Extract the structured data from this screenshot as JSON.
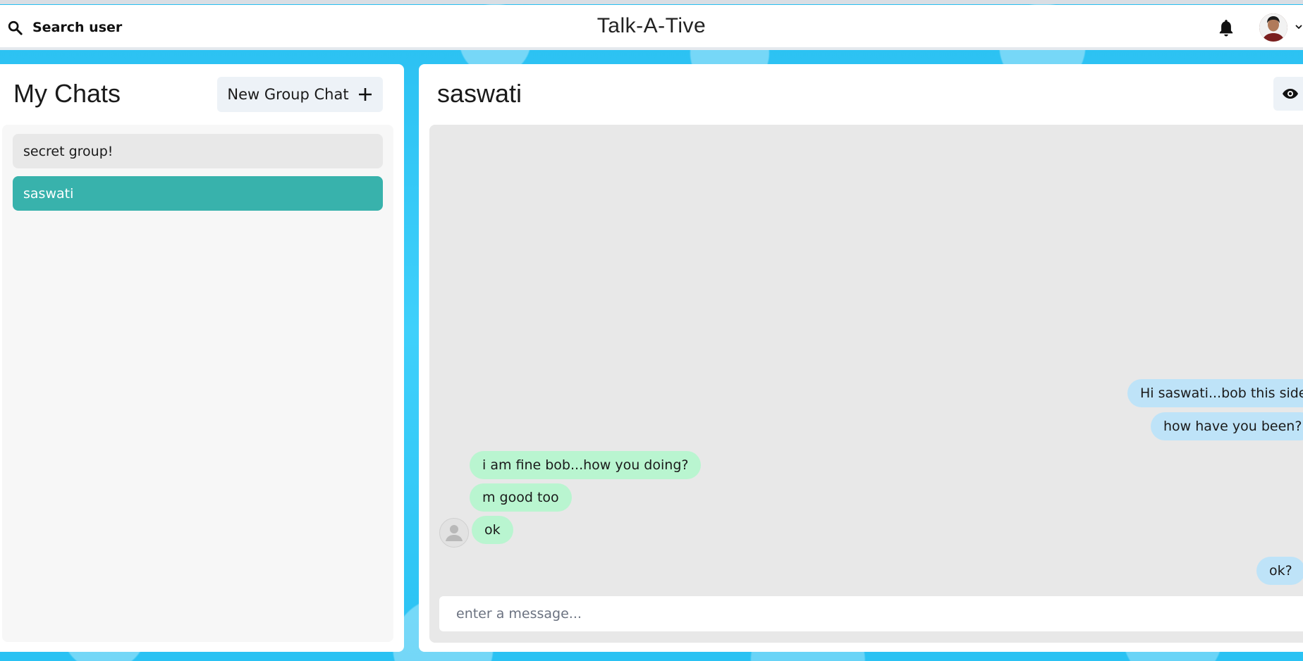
{
  "header": {
    "search_label": "Search user",
    "app_title": "Talk-A-Tive"
  },
  "sidebar": {
    "title": "My Chats",
    "new_group_label": "New Group Chat",
    "chats": [
      {
        "name": "secret group!",
        "active": false
      },
      {
        "name": "saswati",
        "active": true
      }
    ]
  },
  "chat": {
    "name": "saswati",
    "messages": [
      {
        "text": "Hi saswati...bob this side",
        "from": "me"
      },
      {
        "text": "how have you been?",
        "from": "me"
      },
      {
        "text": "i am fine bob...how you doing?",
        "from": "them"
      },
      {
        "text": "m good too",
        "from": "them"
      },
      {
        "text": "ok",
        "from": "them"
      },
      {
        "text": "ok?",
        "from": "me"
      }
    ],
    "input_placeholder": "enter a message..."
  },
  "colors": {
    "accent": "#38b2ac",
    "my_bubble": "#bee3f8",
    "their_bubble": "#b9f5d0",
    "background": "#2bc4f3"
  }
}
